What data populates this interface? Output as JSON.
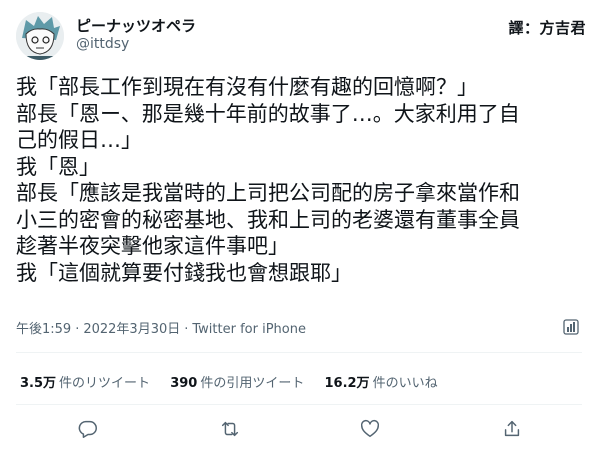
{
  "tweet": {
    "author": {
      "display_name": "ピーナッツオペラ",
      "handle": "@ittdsy"
    },
    "translator_credit": "譯：方吉君",
    "body_lines": [
      "我「部長工作到現在有沒有什麼有趣的回憶啊？」",
      "部長「恩ー、那是幾十年前的故事了…。大家利用了自",
      "己的假日…」",
      "我「恩」",
      "部長「應該是我當時的上司把公司配的房子拿來當作和",
      "小三的密會的秘密基地、我和上司的老婆還有董事全員",
      "趁著半夜突擊他家這件事吧」",
      "我「這個就算要付錢我也會想跟耶」"
    ],
    "time": "午後1:59",
    "separator": "·",
    "date": "2022年3月30日",
    "source": "Twitter for iPhone",
    "stats": {
      "retweets_count": "3.5万",
      "retweets_label": "件のリツイート",
      "quotes_count": "390",
      "quotes_label": "件の引用ツイート",
      "likes_count": "16.2万",
      "likes_label": "件のいいね"
    },
    "actions": [
      "reply-icon",
      "retweet-icon",
      "like-icon",
      "share-icon"
    ]
  },
  "colors": {
    "text": "#0f1419",
    "secondary": "#536471",
    "divider": "#eff3f4"
  }
}
